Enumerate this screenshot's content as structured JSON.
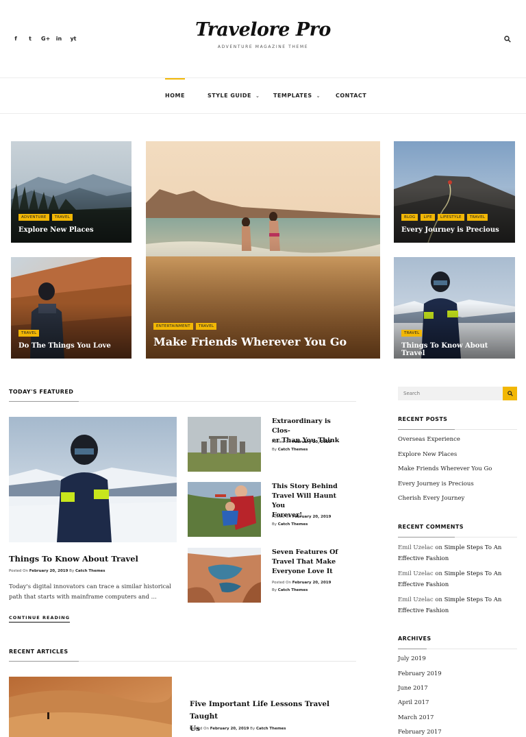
{
  "header": {
    "site_title": "Travelore Pro",
    "tagline": "ADVENTURE MAGAZINE THEME",
    "social": [
      "f",
      "t",
      "G+",
      "in",
      "yt"
    ]
  },
  "nav": {
    "items": [
      {
        "label": "HOME",
        "active": true,
        "dropdown": false
      },
      {
        "label": "STYLE GUIDE",
        "active": false,
        "dropdown": true
      },
      {
        "label": "TEMPLATES",
        "active": false,
        "dropdown": true
      },
      {
        "label": "CONTACT",
        "active": false,
        "dropdown": false
      }
    ]
  },
  "hero": {
    "cards": [
      {
        "title": "Explore New Places",
        "tags": [
          "ADVENTURE",
          "TRAVEL"
        ]
      },
      {
        "title": "Do The Things You Love",
        "tags": [
          "TRAVEL"
        ]
      },
      {
        "title": "Make Friends Wherever You Go",
        "tags": [
          "ENTERTAINMENT",
          "TRAVEL"
        ]
      },
      {
        "title": "Every Journey is Precious",
        "tags": [
          "BLOG",
          "LIFE",
          "LIFESTYLE",
          "TRAVEL"
        ]
      },
      {
        "title": "Things To Know About Travel",
        "tags": [
          "TRAVEL"
        ]
      }
    ]
  },
  "featured": {
    "heading": "TODAY'S FEATURED",
    "main": {
      "title": "Things To Know About Travel",
      "posted_on": "Posted On",
      "date": "February 20, 2019",
      "by": "By",
      "author": "Catch Themes",
      "excerpt": "Today's digital innovators can trace a similar historical path that starts with mainframe computers and ...",
      "continue_label": "CONTINUE READING"
    },
    "side_posts": [
      {
        "title_line1": "Extraordinary is Clos-",
        "title_line2": "er Than You Think",
        "title_line3": "",
        "posted_on": "Posted On",
        "date": "February 20, 2019",
        "by": "By",
        "author": "Catch Themes"
      },
      {
        "title_line1": "This Story Behind",
        "title_line2": "Travel Will Haunt You",
        "title_line3": "Forever!",
        "posted_on": "Posted On",
        "date": "February 20, 2019",
        "by": "By",
        "author": "Catch Themes"
      },
      {
        "title_line1": "Seven Features Of",
        "title_line2": "Travel That Make",
        "title_line3": "Everyone Love It",
        "posted_on": "Posted On",
        "date": "February 20, 2019",
        "by": "By",
        "author": "Catch Themes"
      }
    ]
  },
  "recent_articles": {
    "heading": "RECENT ARTICLES",
    "post": {
      "title_line1": "Five Important Life Lessons Travel Taught",
      "title_line2": "Us",
      "posted_on": "Posted On",
      "date": "February 20, 2019",
      "by": "By",
      "author": "Catch Themes"
    }
  },
  "sidebar": {
    "search_placeholder": "Search",
    "recent_posts_heading": "RECENT POSTS",
    "recent_posts": [
      "Overseas Experience",
      "Explore New Places",
      "Make Friends Wherever You Go",
      "Every Journey is Precious",
      "Cherish Every Journey"
    ],
    "recent_comments_heading": "RECENT COMMENTS",
    "recent_comments": [
      {
        "author": "Emil Uzelac",
        "on": "on",
        "post_line1": "Simple Steps To An",
        "post_line2": "Effective Fashion"
      },
      {
        "author": "Emil Uzelac",
        "on": "on",
        "post_line1": "Simple Steps To An",
        "post_line2": "Effective Fashion"
      },
      {
        "author": "Emil Uzelac",
        "on": "on",
        "post_line1": "Simple Steps To An",
        "post_line2": "Effective Fashion"
      }
    ],
    "archives_heading": "ARCHIVES",
    "archives": [
      "July 2019",
      "February 2019",
      "June 2017",
      "April 2017",
      "March 2017",
      "February 2017"
    ]
  },
  "colors": {
    "accent": "#f2b705",
    "text": "#222222",
    "divider": "#ececec"
  }
}
